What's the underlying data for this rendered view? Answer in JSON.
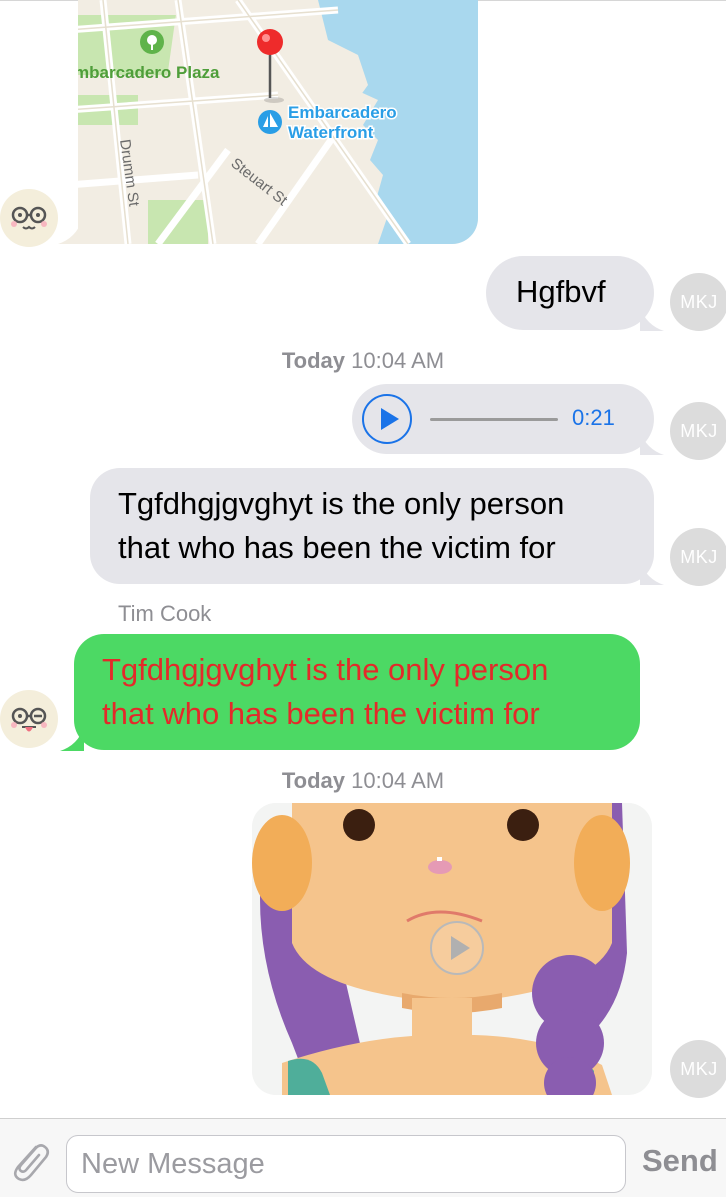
{
  "map": {
    "place_label": "mbarcadero Plaza",
    "poi_label_line1": "Embarcadero",
    "poi_label_line2": "Waterfront",
    "street_drumm": "Drumm St",
    "street_steuart": "Steuart St"
  },
  "avatars": {
    "mkj": "MKJ"
  },
  "messages": {
    "short_text": "Hgfbvf",
    "long_text_line1": "Tgfdhgjgvghyt is the only person",
    "long_text_line2": "that who has been the victim for",
    "reply_line1": "Tgfdhgjgvghyt is the only person",
    "reply_line2": "that who has been the victim for"
  },
  "timestamps": [
    {
      "day": "Today",
      "time": "10:04 AM"
    },
    {
      "day": "Today",
      "time": "10:04 AM"
    }
  ],
  "audio": {
    "duration": "0:21"
  },
  "sender": {
    "name": "Tim Cook"
  },
  "composer": {
    "placeholder": "New Message",
    "send_label": "Send"
  },
  "colors": {
    "gray_bubble": "#e5e5ea",
    "green_bubble": "#4cd964",
    "reply_text": "#e32a2a",
    "accent_blue": "#1a73e8",
    "water": "#a9d8ee",
    "park": "#c8e6b0"
  },
  "icons": {
    "attach": "paperclip-icon",
    "play": "play-icon",
    "pin": "map-pin-icon",
    "poi": "sailboat-icon",
    "park": "tree-icon"
  }
}
